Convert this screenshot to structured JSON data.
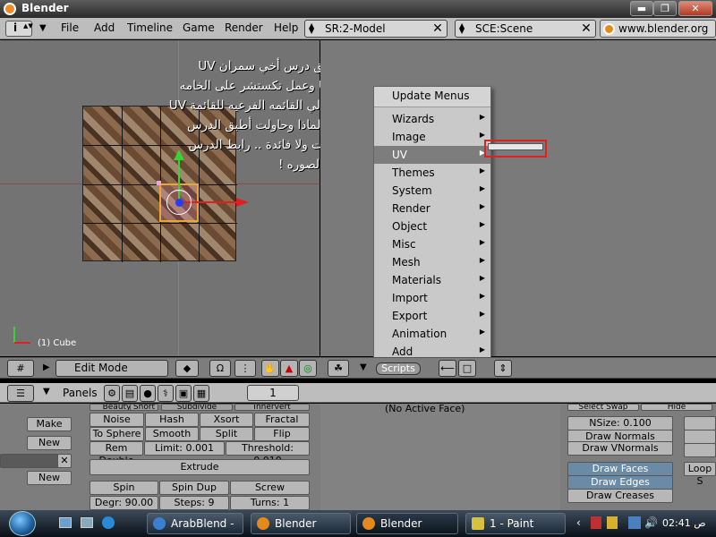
{
  "window": {
    "title": "Blender"
  },
  "topmenu": {
    "items": [
      "File",
      "Add",
      "Timeline",
      "Game",
      "Render",
      "Help"
    ]
  },
  "screen_field": {
    "value": "SR:2-Model"
  },
  "scene_field": {
    "value": "SCE:Scene"
  },
  "url": "www.blender.org 2",
  "viewport": {
    "note_lines": [
      "عند تطبيق درس أخي سمران UV",
      "Unwrap وعمل تكستشر على الخامه",
      "لم تظهر لي القائمه الفرعيه للقائمة UV",
      "ولا أدري لماذا وحاولت أطبق الدرس",
      "ثلاث مرات ولا فائدة .. رابط الدرس",
      "بعد هذه الصوره !"
    ],
    "object_label": "(1) Cube"
  },
  "scripts_menu": {
    "header": "Update Menus",
    "items": [
      "Wizards",
      "Image",
      "UV",
      "Themes",
      "System",
      "Render",
      "Object",
      "Misc",
      "Mesh",
      "Materials",
      "Import",
      "Export",
      "Animation",
      "Add"
    ],
    "active": "UV"
  },
  "viewport_header": {
    "mode": "Edit Mode",
    "scripts_label": "Scripts"
  },
  "panels": {
    "label": "Panels",
    "page": "1"
  },
  "buttons": {
    "left": [
      "Make",
      "New",
      "New"
    ],
    "mesh_tools_row0": [
      "Beauty",
      "Short",
      "Subdivide",
      "Innervert"
    ],
    "row1": [
      "Noise",
      "Hash",
      "Xsort",
      "Fractal"
    ],
    "row2": [
      "To Sphere",
      "Smooth",
      "Split",
      "Flip Normals"
    ],
    "rem_double": "Rem Double",
    "limit": "Limit: 0.001",
    "threshold": "Threshold: 0.010",
    "extrude": "Extrude",
    "spin_row": [
      "Spin",
      "Spin Dup",
      "Screw"
    ],
    "degr": "Degr: 90.00",
    "steps": "Steps: 9",
    "turns": "Turns: 1",
    "no_active_face": "(No Active Face)",
    "select_swap": "Select Swap",
    "hide": "Hide",
    "nsize": "NSize: 0.100",
    "draw_normals": "Draw Normals",
    "draw_vnormals": "Draw VNormals",
    "draw_faces": "Draw Faces",
    "draw_edges": "Draw Edges",
    "draw_creases": "Draw Creases",
    "loop_s": "Loop S"
  },
  "taskbar": {
    "tasks": [
      "ArabBlend - ...",
      "Blender",
      "Blender",
      "1 - Paint"
    ],
    "clock": "02:41 ص"
  },
  "colors": {
    "accent_red": "#e02020",
    "axis_green": "#35d535",
    "axis_blue": "#2a3cf0",
    "selection_orange": "#e8a830"
  }
}
